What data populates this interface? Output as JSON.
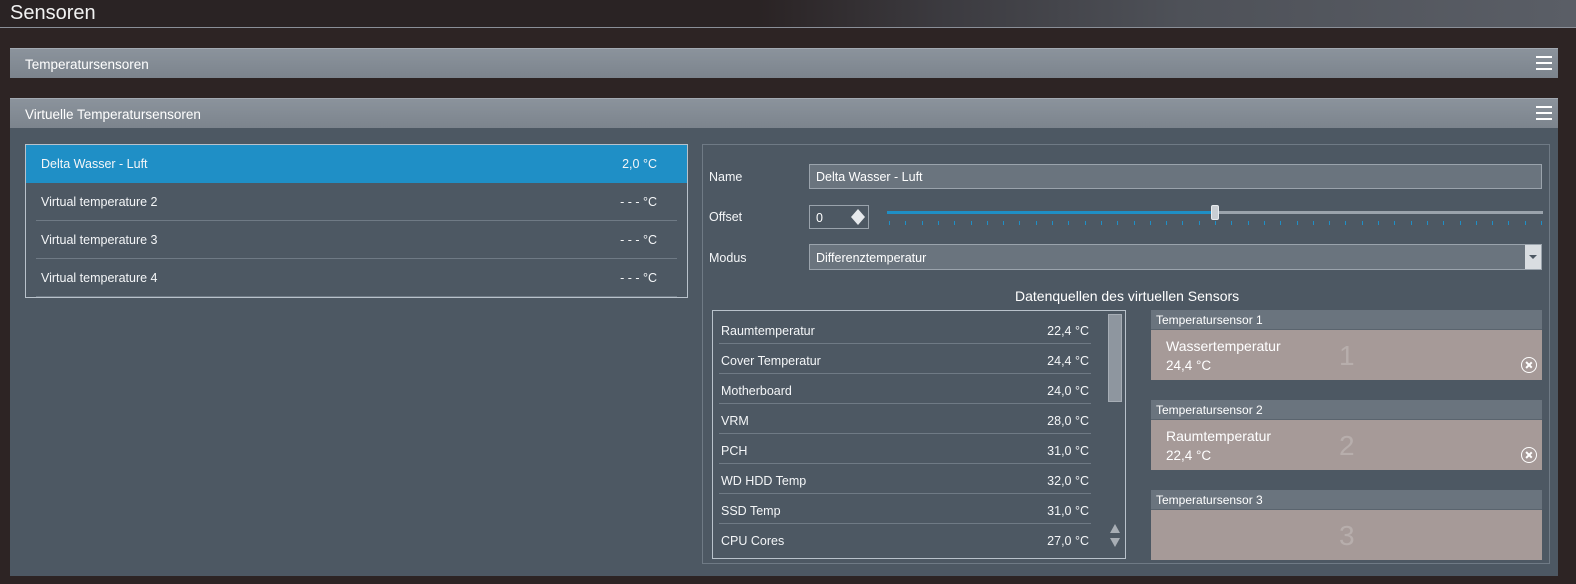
{
  "window": {
    "title": "Sensoren"
  },
  "panels": {
    "temperature": {
      "title": "Temperatursensoren"
    },
    "virtual": {
      "title": "Virtuelle Temperatursensoren"
    }
  },
  "virtual_sensors": [
    {
      "name": "Delta Wasser - Luft",
      "value": "2,0 °C",
      "selected": true
    },
    {
      "name": "Virtual temperature 2",
      "value": "- - - °C",
      "selected": false
    },
    {
      "name": "Virtual temperature 3",
      "value": "- - - °C",
      "selected": false
    },
    {
      "name": "Virtual temperature 4",
      "value": "- - - °C",
      "selected": false
    }
  ],
  "detail": {
    "name_label": "Name",
    "name_value": "Delta Wasser - Luft",
    "offset_label": "Offset",
    "offset_value": "0",
    "offset_slider_fraction": 0.5,
    "mode_label": "Modus",
    "mode_value": "Differenztemperatur",
    "sources_title": "Datenquellen des virtuellen Sensors"
  },
  "data_sources": [
    {
      "name": "Raumtemperatur",
      "value": "22,4 °C"
    },
    {
      "name": "Cover Temperatur",
      "value": "24,4 °C"
    },
    {
      "name": "Motherboard",
      "value": "24,0 °C"
    },
    {
      "name": "VRM",
      "value": "28,0 °C"
    },
    {
      "name": "PCH",
      "value": "31,0 °C"
    },
    {
      "name": "WD HDD Temp",
      "value": "32,0 °C"
    },
    {
      "name": "SSD Temp",
      "value": "31,0 °C"
    },
    {
      "name": "CPU Cores",
      "value": "27,0 °C"
    }
  ],
  "slots": [
    {
      "header": "Temperatursensor 1",
      "number": "1",
      "sensor_name": "Wassertemperatur",
      "sensor_value": "24,4 °C"
    },
    {
      "header": "Temperatursensor 2",
      "number": "2",
      "sensor_name": "Raumtemperatur",
      "sensor_value": "22,4 °C"
    },
    {
      "header": "Temperatursensor 3",
      "number": "3",
      "sensor_name": "",
      "sensor_value": ""
    }
  ],
  "colors": {
    "accent": "#1f8fc6",
    "panel_bg": "#4d5863",
    "slot_bg": "#a69a98"
  }
}
